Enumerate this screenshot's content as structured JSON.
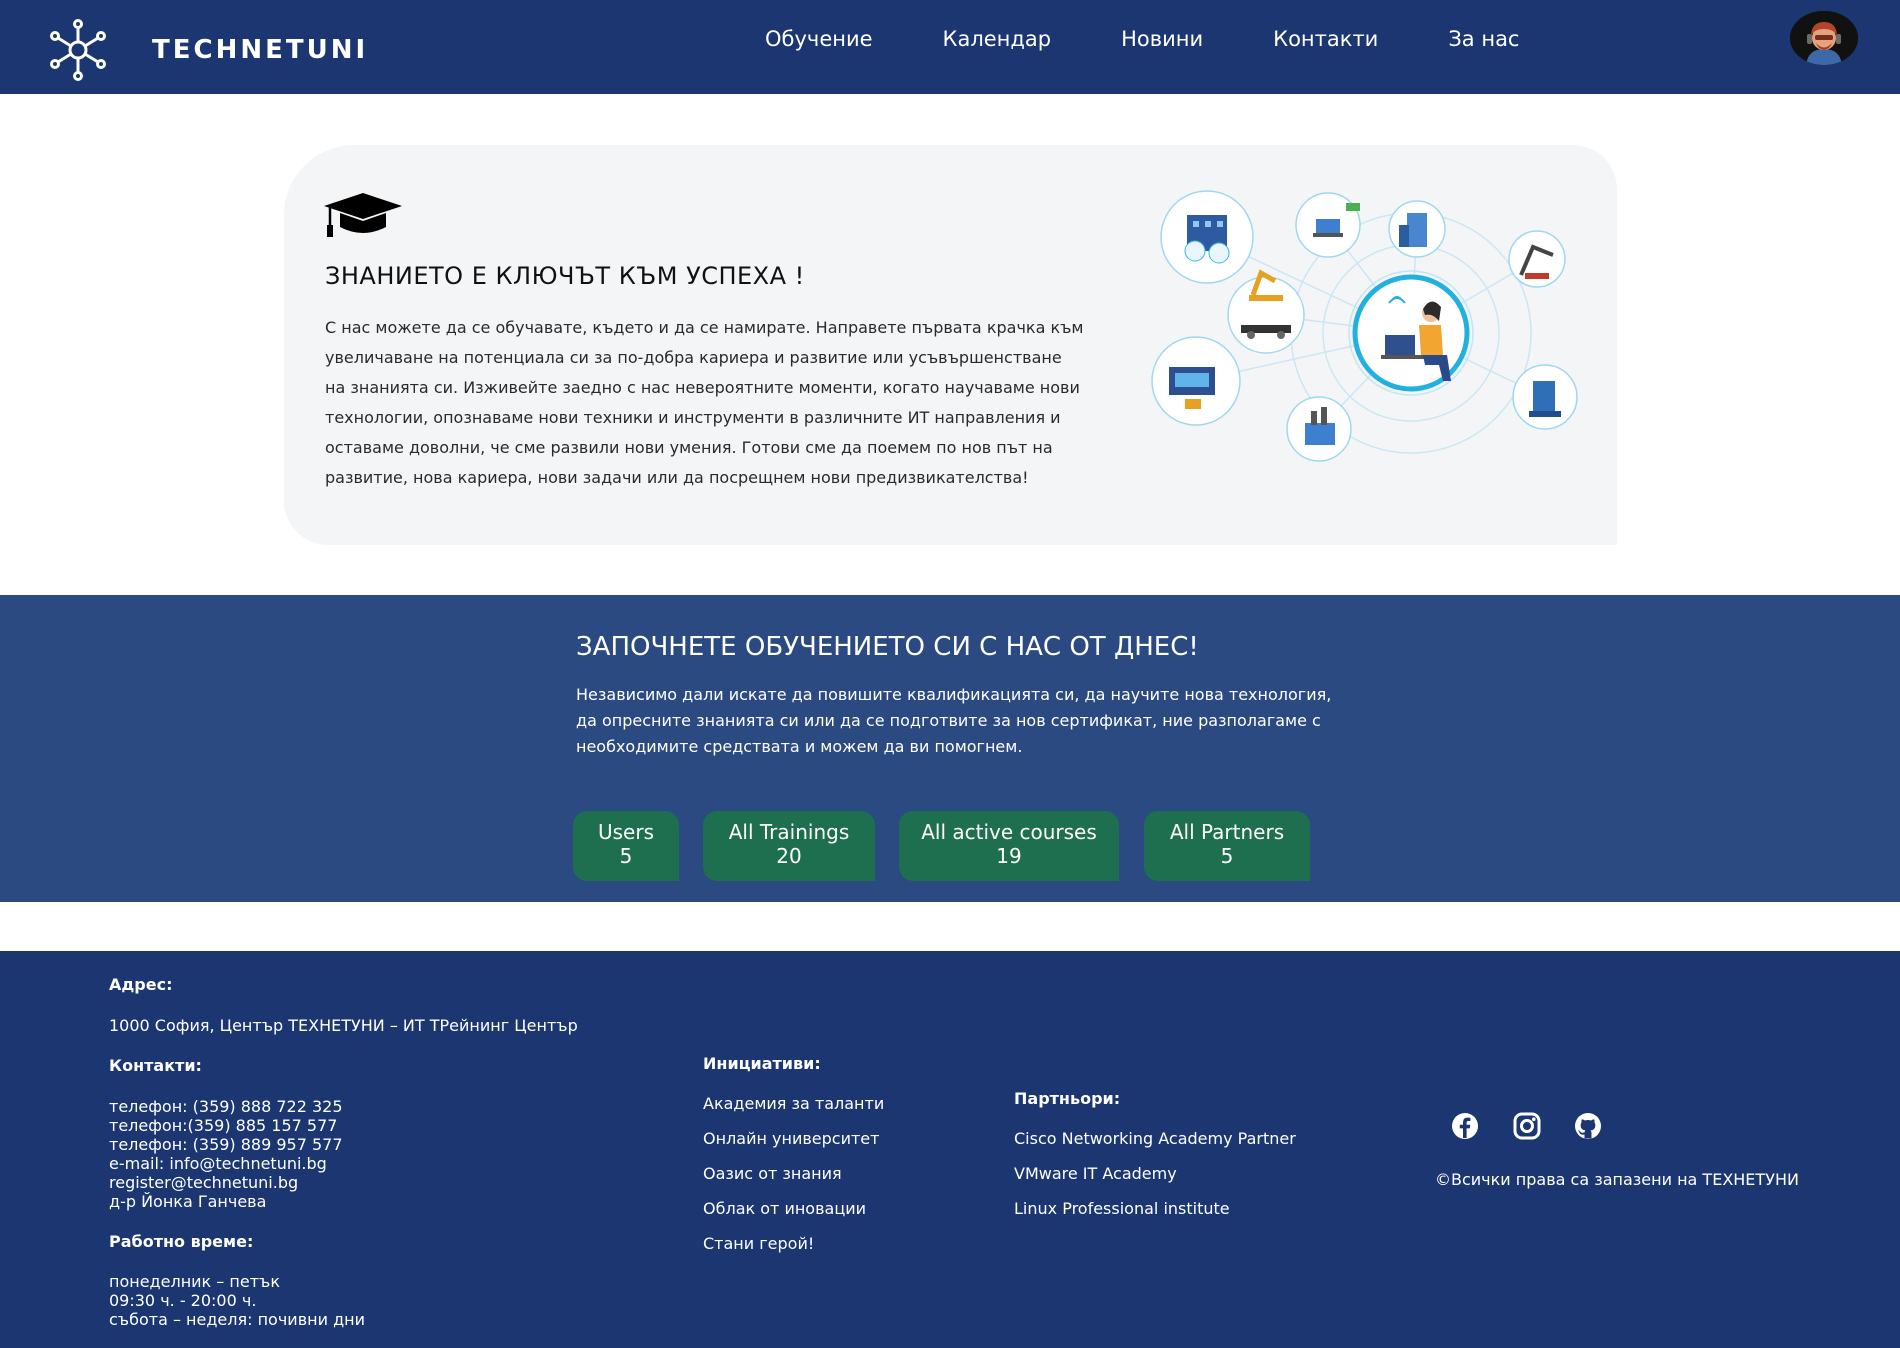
{
  "nav": {
    "brand": "TECHNETUNI",
    "links": [
      "Обучение",
      "Календар",
      "Новини",
      "Контакти",
      "За нас"
    ]
  },
  "hero": {
    "title": "ЗНАНИЕТО Е КЛЮЧЪТ КЪМ УСПЕХА !",
    "text": "С нас можете да се обучавате, където и да се намирате. Направете първата крачка към увеличаване на потенциала си за по-добра кариера и развитие или усъвършенстване на знанията си. Изживейте заедно с нас невероятните моменти, когато научаваме нови технологии, опознаваме нови техники и инструменти в различните ИТ направления и оставаме доволни, че сме развили нови умения. Готови сме да поемем по нов път на развитие, нова кариера, нови задачи или да посрещнем нови предизвикателства!"
  },
  "cta": {
    "title": "ЗАПОЧНЕТЕ ОБУЧЕНИЕТО СИ С НАС ОТ ДНЕС!",
    "text": "Независимо дали искате да повишите квалификацията си, да научите нова технология, да опресните знанията си или да се подготвите за нов сертификат, ние разполагаме с необходимите средствата и можем да ви помогнем.",
    "stats": [
      {
        "label": "Users",
        "value": "5"
      },
      {
        "label": "All Trainings",
        "value": "20"
      },
      {
        "label": "All active courses",
        "value": "19"
      },
      {
        "label": "All Partners",
        "value": "5"
      }
    ]
  },
  "footer": {
    "address_heading": "Адрес:",
    "address": "1000 София, Център ТЕХНЕТУНИ – ИТ ТРейнинг Център",
    "contacts_heading": "Контакти:",
    "contacts": [
      "телефон: (359) 888 722 325",
      "телефон:(359) 885 157 577",
      "телефон: (359) 889 957 577",
      "e-mail: info@technetuni.bg",
      "register@technetuni.bg",
      "д-р Йонка Ганчева"
    ],
    "hours_heading": "Работно време:",
    "hours": [
      "понеделник – петък",
      "09:30 ч. - 20:00 ч.",
      "събота – неделя: почивни дни"
    ],
    "initiatives_heading": "Инициативи:",
    "initiatives": [
      "Академия за таланти",
      "Онлайн университет",
      "Оазис от знания",
      "Облак от иновации",
      "Стани герой!"
    ],
    "partners_heading": "Партньори:",
    "partners": [
      "Cisco Networking Academy Partner",
      "VMware IT Academy",
      "Linux Professional institute"
    ],
    "copyright": "©Всички права са запазени на ТЕХНЕТУНИ"
  },
  "icons": [
    "network-logo-icon",
    "graduation-cap-icon",
    "facebook-icon",
    "instagram-icon",
    "github-icon"
  ],
  "colors": {
    "nav": "#1b3670",
    "cta": "#2b4a82",
    "stat": "#1d6f4f",
    "card": "#f4f5f7"
  }
}
